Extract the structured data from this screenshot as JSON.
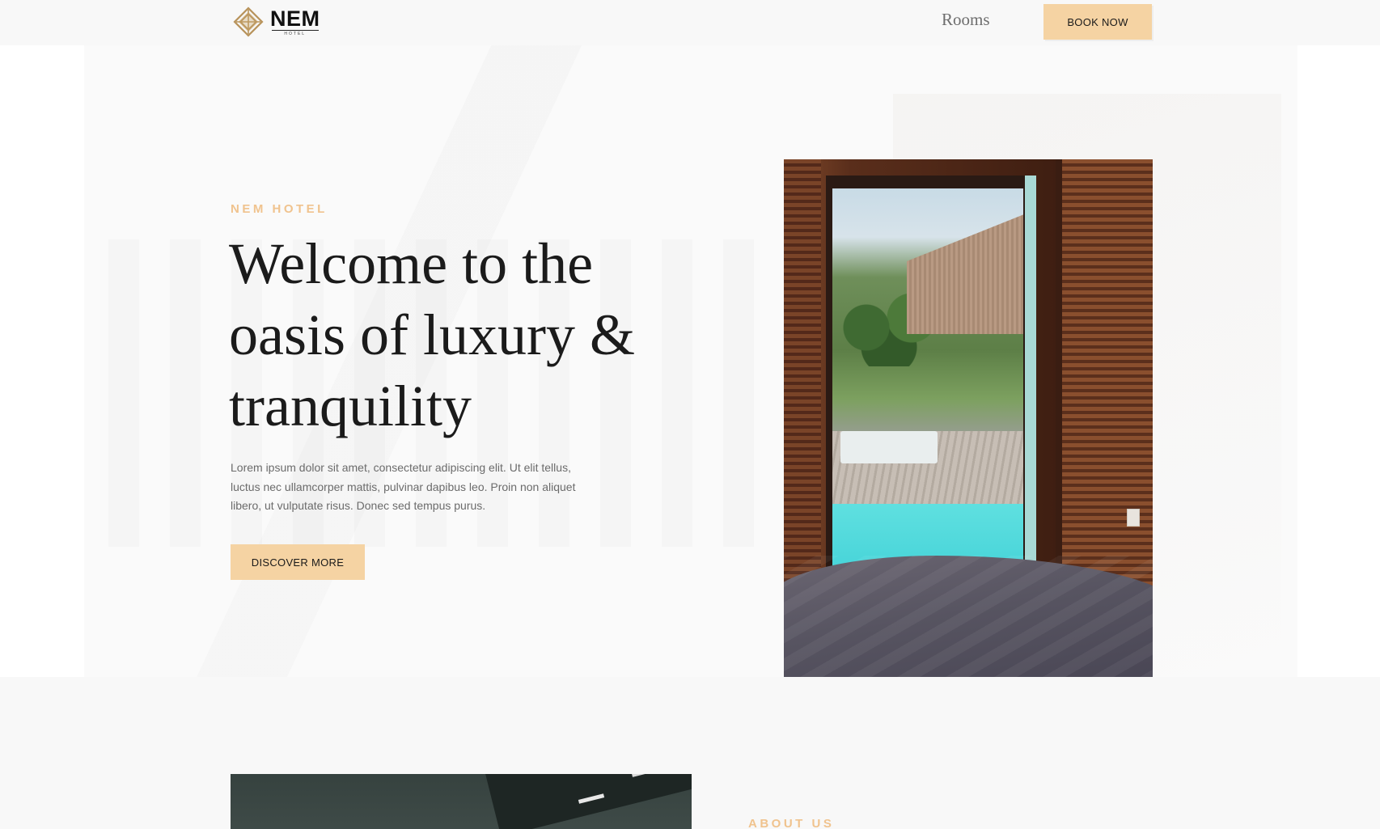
{
  "header": {
    "brand": {
      "name": "NEM",
      "sub": "HOTEL",
      "icon": "diamond-knot-logo-icon"
    },
    "nav": {
      "rooms_label": "Rooms"
    },
    "book_button": "BOOK NOW"
  },
  "hero": {
    "eyebrow": "NEM HOTEL",
    "title_lines": [
      "Welcome to the",
      "oasis of luxury &",
      "tranquility"
    ],
    "description_lines": [
      "Lorem ipsum dolor sit amet, consectetur adipiscing elit. Ut elit tellus,",
      "luctus nec ullamcorper mattis, pulvinar dapibus leo. Proin non aliquet",
      "libero, ut vulputate risus. Donec sed tempus purus."
    ],
    "cta_button": "DISCOVER MORE"
  },
  "about": {
    "eyebrow": "ABOUT US"
  },
  "colors": {
    "accent": "#f5d3a3",
    "eyebrow": "#f0c38e",
    "heading": "#1b1b1b",
    "body_text": "#6b6b6b",
    "page_bg": "#f8f8f8"
  }
}
